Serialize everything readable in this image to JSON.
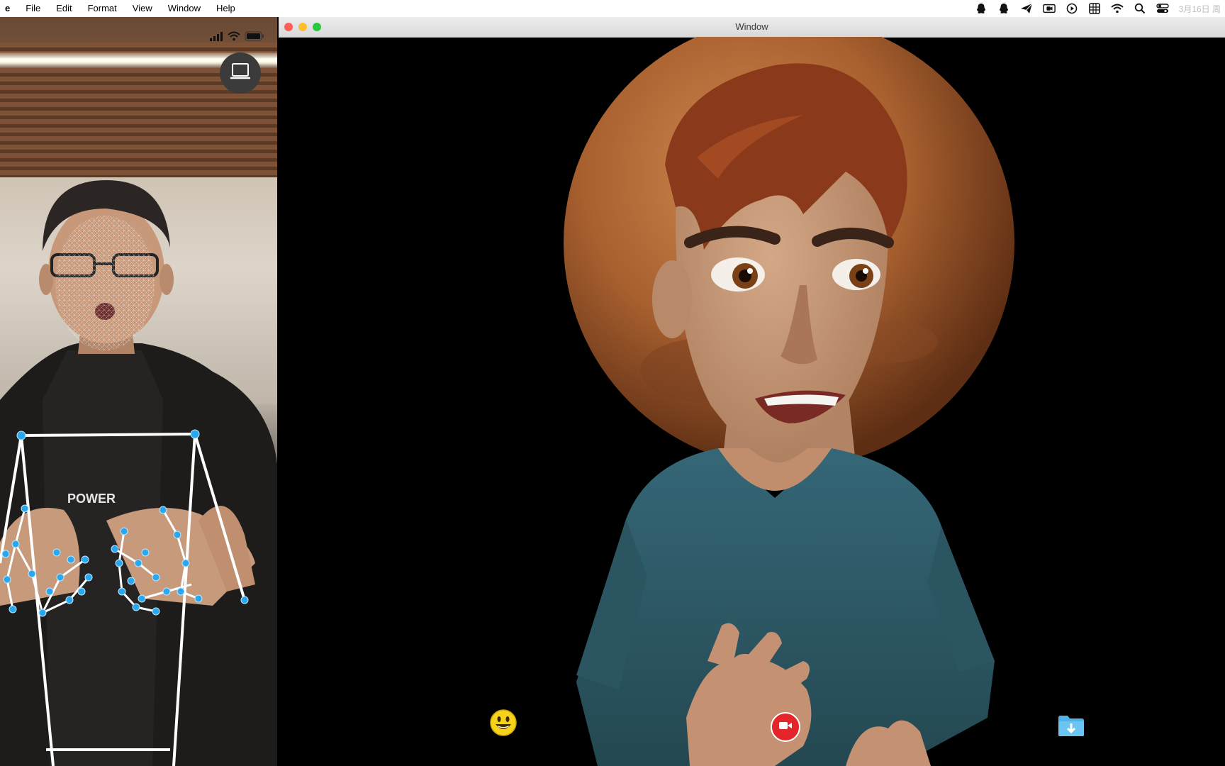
{
  "menubar": {
    "app_name": "e",
    "menus": [
      "File",
      "Edit",
      "Format",
      "View",
      "Window",
      "Help"
    ],
    "status_icons": [
      "qq-icon",
      "qq-icon",
      "send-icon",
      "screen-record-icon",
      "play-icon",
      "grid-icon",
      "wifi-icon",
      "search-icon",
      "control-center-icon"
    ],
    "clock": "3月16日 周"
  },
  "phone": {
    "shirt_text": "POWER"
  },
  "window": {
    "title": "Window",
    "traffic_lights": {
      "close": "#fe5f57",
      "minimize": "#febc2e",
      "zoom": "#28c840"
    }
  },
  "controls": {
    "emoji": "emoji-icon",
    "record": "record-video-icon",
    "download": "download-folder-icon",
    "record_color": "#e3262a",
    "folder_color": "#4fb3e8"
  },
  "colors": {
    "landmark_blue": "#29a8f0",
    "mars": "#b4703f",
    "shirt": "#2f5a66",
    "hair": "#8a3a1a",
    "skin": "#c79a78"
  }
}
